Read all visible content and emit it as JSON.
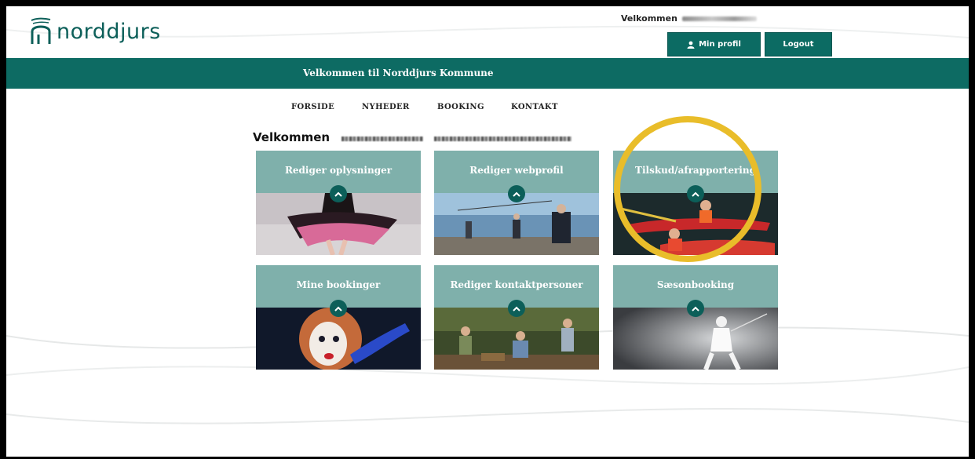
{
  "header": {
    "logo_text": "norddjurs",
    "welcome_label": "Velkommen",
    "profile_button": "Min profil",
    "logout_button": "Logout"
  },
  "banner": {
    "title": "Velkommen til Norddjurs Kommune"
  },
  "nav": {
    "items": [
      {
        "label": "FORSIDE"
      },
      {
        "label": "NYHEDER"
      },
      {
        "label": "BOOKING"
      },
      {
        "label": "KONTAKT"
      }
    ]
  },
  "main": {
    "welcome_heading": "Velkommen",
    "tiles": [
      {
        "title": "Rediger oplysninger",
        "image": "ballet-dancer-tutu"
      },
      {
        "title": "Rediger webprofil",
        "image": "people-fishing-pier"
      },
      {
        "title": "Tilskud/afrapportering",
        "image": "children-kayaking"
      },
      {
        "title": "Mine bookinger",
        "image": "clown-face-paint"
      },
      {
        "title": "Rediger kontaktpersoner",
        "image": "scouts-in-forest"
      },
      {
        "title": "Sæsonbooking",
        "image": "fencer-spotlight"
      }
    ]
  },
  "icons": {
    "profile": "user-icon",
    "tile_toggle": "chevron-up-icon"
  },
  "colors": {
    "brand_teal": "#0d6b63",
    "tile_teal": "#7fb0ab",
    "highlight_yellow": "#e9bd2a"
  }
}
